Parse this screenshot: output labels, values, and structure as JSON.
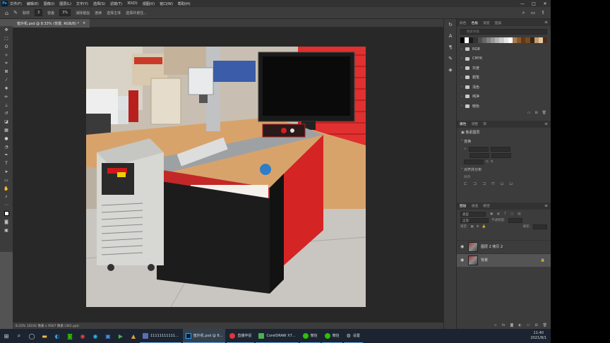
{
  "menubar": {
    "logo": "Ps",
    "items": [
      "文件(F)",
      "编辑(E)",
      "图像(I)",
      "图层(L)",
      "文字(Y)",
      "选择(S)",
      "滤镜(T)",
      "3D(D)",
      "视图(V)",
      "窗口(W)",
      "帮助(H)"
    ],
    "controls": [
      "—",
      "□",
      "✕"
    ]
  },
  "options": {
    "sample_label": "取样",
    "sample_value": "3",
    "tolerance_label": "容差",
    "tolerance_value": "3%",
    "antialias_label": "消除锯齿",
    "contiguous_label": "连续",
    "edge_label": "选择主体",
    "select_label": "选择并遮住..."
  },
  "document": {
    "tab_title": "蜜外机.psd @ 8.33% (背景, RGB/8) *",
    "close": "×"
  },
  "status": {
    "text": "8.33%   10242 像素 x 9567 像素 (301 ppi)"
  },
  "panels": {
    "swatch_tabs": [
      "颜色",
      "色板",
      "渐变",
      "图案"
    ],
    "swatch_search_placeholder": "搜索色板",
    "swatches": [
      "#000000",
      "#ffffff",
      "#1a1a1a",
      "#333333",
      "#4d4d4d",
      "#666666",
      "#808080",
      "#999999",
      "#b3b3b3",
      "#cccccc",
      "#e6e6e6",
      "#ffffff",
      "#a67c52",
      "#8b5a2b",
      "#603913",
      "#754c24",
      "#3b2314",
      "#c69c6d",
      "#e2c9a6",
      "#4c2a1a"
    ],
    "folders": [
      "RGB",
      "CMYK",
      "灰度",
      "蜡笔",
      "浅色",
      "纯净",
      "暗色"
    ],
    "props_tabs": [
      "属性",
      "调整",
      "库"
    ],
    "props_doc": "像素图层",
    "transform_label": "变换",
    "align_label": "对齐并分布",
    "align_to": "对齐:",
    "layer_tabs": [
      "图层",
      "通道",
      "路径"
    ],
    "layer_filter": "类型",
    "blend_mode": "正常",
    "opacity_label": "不透明度:",
    "lock_label": "锁定:",
    "fill_label": "填充:",
    "layers": [
      {
        "name": "图层 2 拷贝 2",
        "selected": false
      },
      {
        "name": "背景",
        "selected": true
      }
    ]
  },
  "taskbar": {
    "apps": [
      {
        "label": "11111111111...",
        "color": "#5b6fb0"
      },
      {
        "label": "蜜外机.psd @ 8...",
        "color": "#31a8ff",
        "active": true
      },
      {
        "label": "直播伴侣",
        "color": "#e0353f"
      },
      {
        "label": "CorelDRAW X7...",
        "color": "#4caf50"
      },
      {
        "label": "微信",
        "color": "#2dc100"
      },
      {
        "label": "微信",
        "color": "#2dc100"
      },
      {
        "label": "设置",
        "color": "#bbbbbb"
      }
    ],
    "time": "11:40",
    "date": "2021/8/1"
  }
}
